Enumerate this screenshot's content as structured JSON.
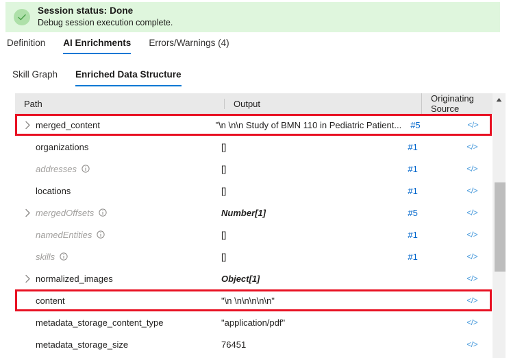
{
  "status": {
    "icon": "checkmark-circle-icon",
    "title": "Session status: Done",
    "subtitle": "Debug session execution complete.",
    "bg_color": "#dff6dd",
    "icon_bg_color": "#aee0a9",
    "icon_color": "#3d9142"
  },
  "primary_tabs": [
    {
      "label": "Definition",
      "active": false
    },
    {
      "label": "AI Enrichments",
      "active": true
    },
    {
      "label": "Errors/Warnings (4)",
      "active": false
    }
  ],
  "secondary_tabs": [
    {
      "label": "Skill Graph",
      "active": false
    },
    {
      "label": "Enriched Data Structure",
      "active": true
    }
  ],
  "accent_color": "#0078d4",
  "highlight_color": "#e81123",
  "table": {
    "columns": [
      "Path",
      "Output",
      "Originating Source"
    ],
    "code_icon": "</>",
    "info_icon": "info-circle-icon",
    "rows": [
      {
        "path": "merged_content",
        "expandable": true,
        "muted": false,
        "info": false,
        "output": "\"\\n \\n\\n Study of BMN 110 in Pediatric Patient...",
        "output_is_type": false,
        "source": "#5",
        "code": true,
        "highlighted": true
      },
      {
        "path": "organizations",
        "expandable": false,
        "muted": false,
        "info": false,
        "output": "[]",
        "output_is_type": false,
        "source": "#1",
        "code": true,
        "highlighted": false
      },
      {
        "path": "addresses",
        "expandable": false,
        "muted": true,
        "info": true,
        "output": "[]",
        "output_is_type": false,
        "source": "#1",
        "code": true,
        "highlighted": false
      },
      {
        "path": "locations",
        "expandable": false,
        "muted": false,
        "info": false,
        "output": "[]",
        "output_is_type": false,
        "source": "#1",
        "code": true,
        "highlighted": false
      },
      {
        "path": "mergedOffsets",
        "expandable": true,
        "muted": true,
        "info": true,
        "output": "Number[1]",
        "output_is_type": true,
        "source": "#5",
        "code": true,
        "highlighted": false
      },
      {
        "path": "namedEntities",
        "expandable": false,
        "muted": true,
        "info": true,
        "output": "[]",
        "output_is_type": false,
        "source": "#1",
        "code": true,
        "highlighted": false
      },
      {
        "path": "skills",
        "expandable": false,
        "muted": true,
        "info": true,
        "output": "[]",
        "output_is_type": false,
        "source": "#1",
        "code": true,
        "highlighted": false
      },
      {
        "path": "normalized_images",
        "expandable": true,
        "muted": false,
        "info": false,
        "output": "Object[1]",
        "output_is_type": true,
        "source": "",
        "code": true,
        "highlighted": false
      },
      {
        "path": "content",
        "expandable": false,
        "muted": false,
        "info": false,
        "output": "\"\\n \\n\\n\\n\\n\\n\"",
        "output_is_type": false,
        "source": "",
        "code": true,
        "highlighted": true
      },
      {
        "path": "metadata_storage_content_type",
        "expandable": false,
        "muted": false,
        "info": false,
        "output": "\"application/pdf\"",
        "output_is_type": false,
        "source": "",
        "code": true,
        "highlighted": false
      },
      {
        "path": "metadata_storage_size",
        "expandable": false,
        "muted": false,
        "info": false,
        "output": "76451",
        "output_is_type": false,
        "source": "",
        "code": true,
        "highlighted": false
      }
    ]
  },
  "scrollbar": {
    "up_arrow": "▲"
  }
}
